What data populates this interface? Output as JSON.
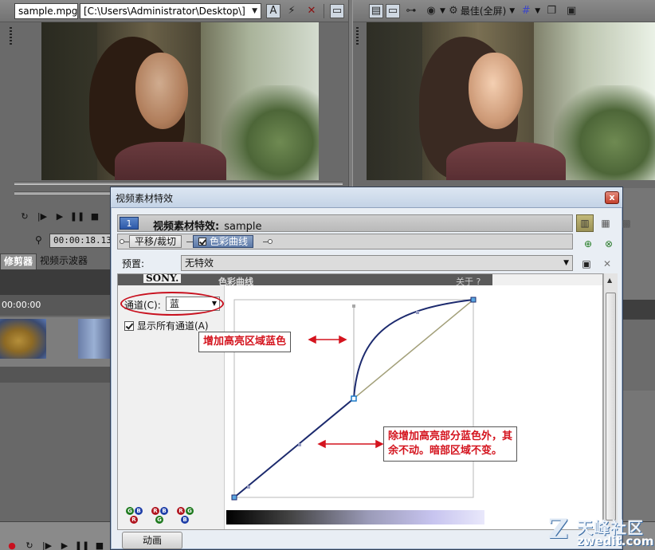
{
  "preview": {
    "file_combo": "sample.mpg",
    "path_combo": "[C:\\Users\\Administrator\\Desktop\\]",
    "quality_label": "最佳(全屏)",
    "timecode": "00:00:18.13",
    "tabs": [
      "修剪器",
      "视频示波器"
    ]
  },
  "timeline": {
    "ruler_time": "00:00:00"
  },
  "dialog": {
    "title": "视频素材特效",
    "close_label": "x",
    "chain_number": "1",
    "chain_heading": "视频素材特效:",
    "chain_clip": "sample",
    "plugins": [
      "平移/裁切",
      "色彩曲线"
    ],
    "preset_label": "预置:",
    "preset_value": "无特效",
    "plugin_panel": {
      "brand": "SONY.",
      "name": "色彩曲线",
      "about": "关于 ?",
      "channel_label": "通道(C):",
      "channel_value": "蓝",
      "show_all_label": "显示所有通道(A)",
      "rgb_icons": [
        {
          "top": "G",
          "right": "B",
          "bottom": "R"
        },
        {
          "top": "R",
          "right": "B",
          "bottom": "G"
        },
        {
          "top": "R",
          "right": "G",
          "bottom": "B"
        }
      ]
    },
    "annotations": {
      "highlight": "增加高亮区域蓝色",
      "rest_line1": "除增加高亮部分蓝色外，其",
      "rest_line2": "余不动。暗部区域不变。"
    },
    "animate_button": "动画"
  },
  "watermark": {
    "letter": "Z",
    "cn": "天峰社区",
    "url": "zwedit.com"
  },
  "colors": {
    "accent_red": "#d4141e",
    "curve_blue": "#1c2a6e",
    "diagonal": "#a3a07a"
  }
}
